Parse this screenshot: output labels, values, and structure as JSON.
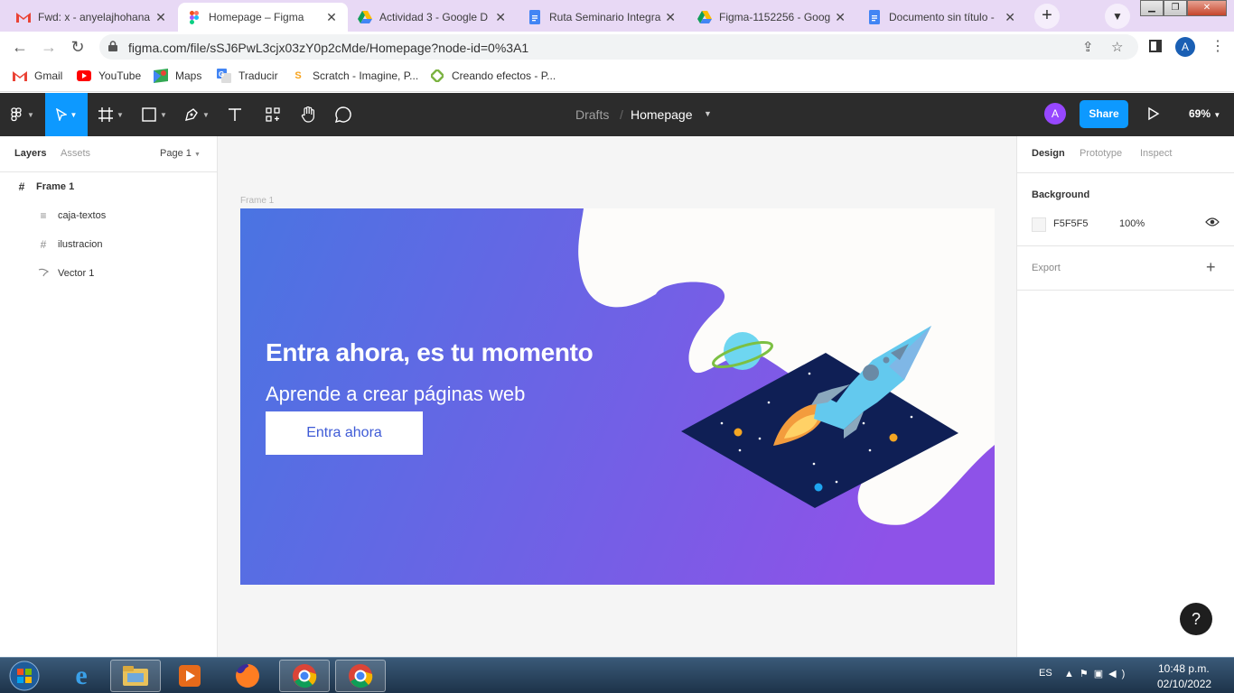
{
  "browser": {
    "tabs": [
      {
        "title": "Fwd: x - anyelajhohana",
        "icon": "gmail-icon"
      },
      {
        "title": "Homepage – Figma",
        "icon": "figma-icon",
        "active": true
      },
      {
        "title": "Actividad 3 - Google D",
        "icon": "google-drive-icon"
      },
      {
        "title": "Ruta Seminario Integra",
        "icon": "google-docs-icon"
      },
      {
        "title": "Figma-1152256 - Goog",
        "icon": "google-drive-icon"
      },
      {
        "title": "Documento sin título -",
        "icon": "google-docs-icon"
      }
    ],
    "new_tab": "+",
    "url": "figma.com/file/sSJ6PwL3cjx03zY0p2cMde/Homepage?node-id=0%3A1",
    "profile_initial": "A",
    "bookmarks": [
      {
        "label": "Gmail",
        "icon": "gmail-icon"
      },
      {
        "label": "YouTube",
        "icon": "youtube-icon"
      },
      {
        "label": "Maps",
        "icon": "maps-icon"
      },
      {
        "label": "Traducir",
        "icon": "translate-icon"
      },
      {
        "label": "Scratch - Imagine, P...",
        "icon": "scratch-icon"
      },
      {
        "label": "Creando efectos - P...",
        "icon": "bookmark-icon"
      }
    ]
  },
  "figma": {
    "breadcrumb": {
      "folder": "Drafts",
      "separator": "/",
      "file": "Homepage"
    },
    "avatar_initial": "A",
    "share_label": "Share",
    "zoom": "69%",
    "left_panel": {
      "tabs": [
        "Layers",
        "Assets"
      ],
      "page": "Page 1",
      "layers": [
        {
          "name": "Frame 1",
          "icon": "frame-icon",
          "level": 0
        },
        {
          "name": "caja-textos",
          "icon": "text-layer-icon",
          "level": 1
        },
        {
          "name": "ilustracion",
          "icon": "frame-icon",
          "level": 1
        },
        {
          "name": "Vector 1",
          "icon": "vector-icon",
          "level": 1
        }
      ]
    },
    "canvas": {
      "frame_label": "Frame 1",
      "hero": {
        "title": "Entra ahora, es tu momento",
        "subtitle": "Aprende a crear páginas web",
        "cta": "Entra ahora"
      },
      "colors": {
        "gradient_start": "#4a74e2",
        "gradient_end": "#8e52e8",
        "blob": "#fdfcfa",
        "space": "#0f1f55"
      }
    },
    "right_panel": {
      "tabs": [
        "Design",
        "Prototype",
        "Inspect"
      ],
      "background_title": "Background",
      "background_hex": "F5F5F5",
      "background_opacity": "100%",
      "export_title": "Export"
    },
    "help": "?"
  },
  "taskbar": {
    "lang": "ES",
    "time": "10:48 p.m.",
    "date": "02/10/2022"
  }
}
